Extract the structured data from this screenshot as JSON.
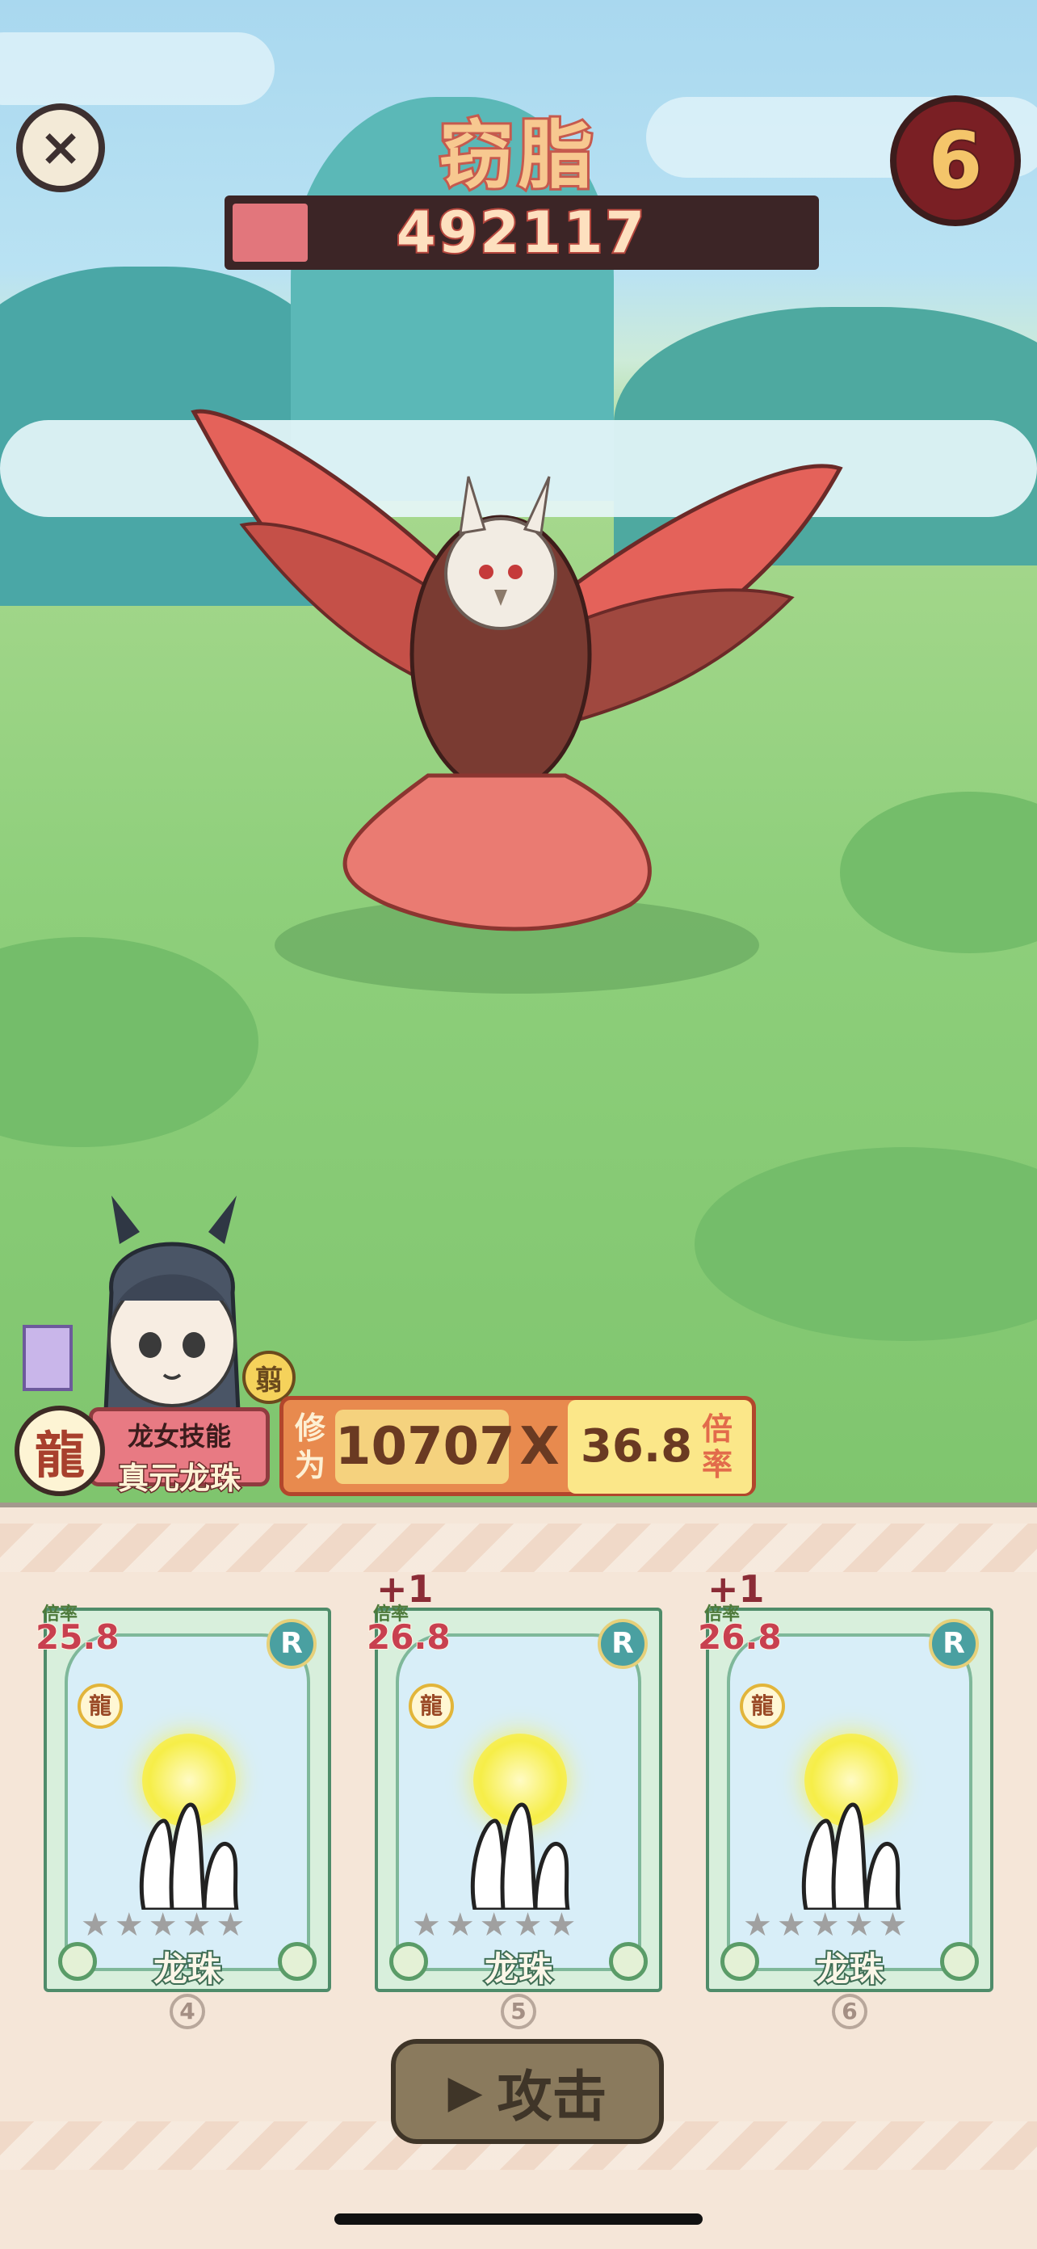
{
  "boss": {
    "name": "窃脂",
    "hp": "492117",
    "hp_fraction": 0.13
  },
  "round": "6",
  "hero": {
    "element": "龍",
    "skill_title": "龙女技能",
    "skill_name": "真元龙珠",
    "tag": "翦"
  },
  "score": {
    "xiuwei_label": "修为",
    "xiuwei": "10707",
    "x": "X",
    "beilv": "36.8",
    "beilv_label": "倍率"
  },
  "cards": [
    {
      "rate_label": "倍率",
      "rate": "25.8",
      "rank": "R",
      "element": "龍",
      "name": "龙珠",
      "bonus": "",
      "number": "4"
    },
    {
      "rate_label": "倍率",
      "rate": "26.8",
      "rank": "R",
      "element": "龍",
      "name": "龙珠",
      "bonus": "+1",
      "number": "5"
    },
    {
      "rate_label": "倍率",
      "rate": "26.8",
      "rank": "R",
      "element": "龍",
      "name": "龙珠",
      "bonus": "+1",
      "number": "6"
    }
  ],
  "attack_label": "攻击",
  "icons": {
    "close": "close-icon",
    "card": "card-icon",
    "star": "star-icon"
  },
  "colors": {
    "hp_fill": "#e2767c",
    "hp_bg": "#3c2526",
    "rate": "#c8404f",
    "panel": "#e88a4e"
  }
}
